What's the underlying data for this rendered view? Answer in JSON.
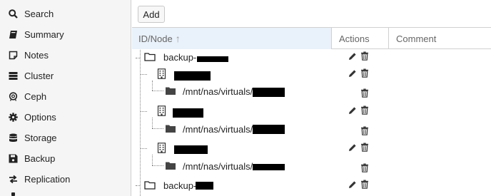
{
  "sidebar": {
    "items": [
      {
        "label": "Search",
        "icon": "search-icon"
      },
      {
        "label": "Summary",
        "icon": "book-icon"
      },
      {
        "label": "Notes",
        "icon": "notes-icon"
      },
      {
        "label": "Cluster",
        "icon": "server-icon"
      },
      {
        "label": "Ceph",
        "icon": "ceph-icon"
      },
      {
        "label": "Options",
        "icon": "gear-icon"
      },
      {
        "label": "Storage",
        "icon": "database-icon"
      },
      {
        "label": "Backup",
        "icon": "floppy-icon"
      },
      {
        "label": "Replication",
        "icon": "replication-icon"
      }
    ]
  },
  "toolbar": {
    "add_label": "Add"
  },
  "grid": {
    "columns": {
      "id": "ID/Node",
      "sort_indicator": "↑",
      "actions": "Actions",
      "comment": "Comment"
    },
    "rows": [
      {
        "text": "backup-",
        "type": "folder"
      },
      {
        "text": "",
        "type": "node"
      },
      {
        "text": "/mnt/nas/virtuals/",
        "type": "dir"
      },
      {
        "text": "",
        "type": "node"
      },
      {
        "text": "/mnt/nas/virtuals/",
        "type": "dir"
      },
      {
        "text": "",
        "type": "node"
      },
      {
        "text": "/mnt/nas/virtuals/",
        "type": "dir"
      },
      {
        "text": "backup-",
        "type": "folder"
      }
    ]
  }
}
